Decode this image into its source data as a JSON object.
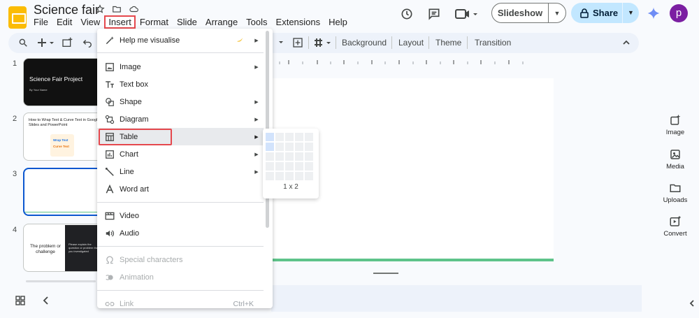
{
  "doc": {
    "title": "Science fair"
  },
  "menubar": [
    "File",
    "Edit",
    "View",
    "Insert",
    "Format",
    "Slide",
    "Arrange",
    "Tools",
    "Extensions",
    "Help"
  ],
  "header": {
    "slideshow_label": "Slideshow",
    "share_label": "Share",
    "avatar_initial": "p"
  },
  "toolbar": {
    "background": "Background",
    "layout": "Layout",
    "theme": "Theme",
    "transition": "Transition"
  },
  "slides": [
    {
      "num": "1",
      "title": "Science Fair Project",
      "subtitle": "By Your Name"
    },
    {
      "num": "2",
      "title": "How to Wrap Text & Curve Text in Google Slides and PowerPoint",
      "thumb_label": "Wrap Text",
      "thumb_sub": "Curve Text"
    },
    {
      "num": "3"
    },
    {
      "num": "4",
      "left_text": "The problem or challenge",
      "right_text": "Please explain the question or problem that you investigated"
    }
  ],
  "side_panel": [
    "Image",
    "Media",
    "Uploads",
    "Convert"
  ],
  "insert_menu": {
    "items": [
      {
        "label": "Help me visualise",
        "icon": "magic-pen-icon",
        "submenu": true
      },
      {
        "label": "Image",
        "icon": "image-icon",
        "submenu": true
      },
      {
        "label": "Text box",
        "icon": "text-box-icon",
        "submenu": false
      },
      {
        "label": "Shape",
        "icon": "shape-icon",
        "submenu": true
      },
      {
        "label": "Diagram",
        "icon": "diagram-icon",
        "submenu": true
      },
      {
        "label": "Table",
        "icon": "table-icon",
        "submenu": true
      },
      {
        "label": "Chart",
        "icon": "chart-icon",
        "submenu": true
      },
      {
        "label": "Line",
        "icon": "line-icon",
        "submenu": true
      },
      {
        "label": "Word art",
        "icon": "word-art-icon",
        "submenu": false
      },
      {
        "label": "Video",
        "icon": "video-icon",
        "submenu": false
      },
      {
        "label": "Audio",
        "icon": "audio-icon",
        "submenu": false
      },
      {
        "label": "Special characters",
        "icon": "omega-icon",
        "submenu": false,
        "disabled": true
      },
      {
        "label": "Animation",
        "icon": "animation-icon",
        "submenu": false,
        "disabled": true
      },
      {
        "label": "Link",
        "icon": "link-icon",
        "shortcut": "Ctrl+K",
        "disabled": true
      }
    ]
  },
  "table_picker": {
    "size_label": "1 x 2",
    "selected_cols": 1,
    "selected_rows": 2
  },
  "colors": {
    "accent": "#0b57d0",
    "highlight_box": "#e5484d",
    "share_bg": "#c2e7ff",
    "slide_accent_line": "#5ec38a"
  }
}
